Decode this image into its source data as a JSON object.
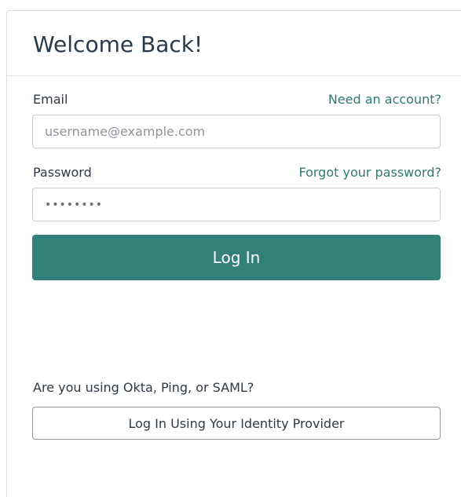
{
  "header": {
    "title": "Welcome Back!"
  },
  "email": {
    "label": "Email",
    "link": "Need an account?",
    "placeholder": "username@example.com",
    "value": ""
  },
  "password": {
    "label": "Password",
    "link": "Forgot your password?",
    "value": "••••••••"
  },
  "actions": {
    "login_label": "Log In"
  },
  "sso": {
    "question": "Are you using Okta, Ping, or SAML?",
    "button_label": "Log In Using Your Identity Provider"
  },
  "colors": {
    "accent": "#338079",
    "link": "#2f7a71",
    "text": "#2f3a45"
  }
}
